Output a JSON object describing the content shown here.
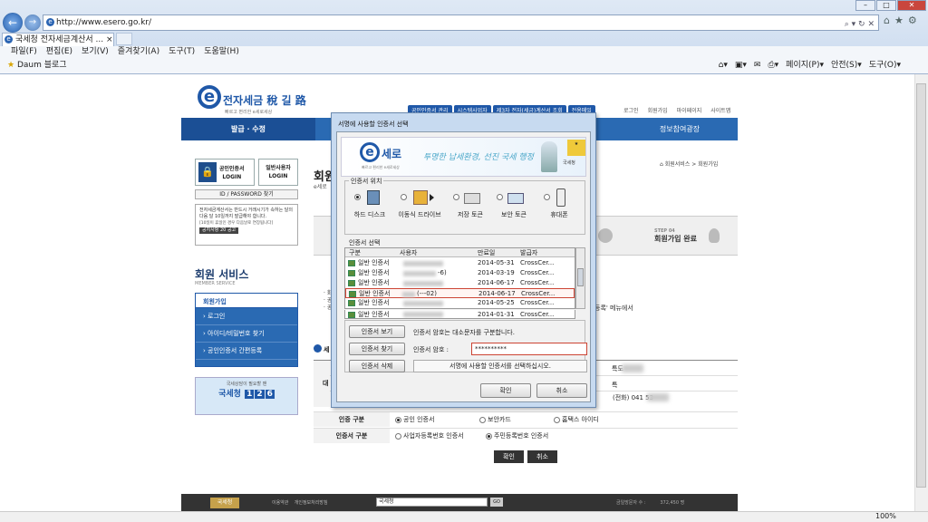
{
  "browser": {
    "url": "http://www.esero.go.kr/",
    "tab_title": "국세청 전자세금계산서 ...",
    "tab_close": "×",
    "menu": [
      "파일(F)",
      "편집(E)",
      "보기(V)",
      "즐겨찾기(A)",
      "도구(T)",
      "도움말(H)"
    ],
    "fav_item": "Daum 블로그",
    "cmd": [
      "페이지(P)▾",
      "안전(S)▾",
      "도구(O)▾"
    ],
    "zoom": "100%"
  },
  "site": {
    "logo_mark": "e",
    "logo_text": "전자세금 稅 길 路",
    "logo_sub": "빠르고 편리한 e세로세상",
    "top_links": [
      "공인인증서 관리",
      "시스템사업자",
      "제3자 전자(세금)계산서 조회",
      "전용메일"
    ],
    "top_links2": [
      "로그인",
      "회원가입",
      "마이페이지",
      "사이트맵"
    ],
    "nav_selected": "발급 · 수정",
    "nav_right": "정보참여광장",
    "cert_login": "공인인증서\nLOGIN",
    "gen_login": "일반사용자\nLOGIN",
    "idpw": "ID / PASSWORD 찾기",
    "notice_main": "전자세금계산서는 반드시 거래시기가 속하는 달의 다음 달 10일까지 발급해야 합니다.",
    "notice_sub": "[10일이 휴일인 경우 다음날로 연장됩니다]",
    "notice_btn": "공지사항 20 공고",
    "service_title": "회원 서비스",
    "service_sub": "MEMBER SERVICE",
    "side_header": "회원가입",
    "side_items": [
      "› 로그인",
      "› 아이디/비밀번호 찾기",
      "› 공인인증서 간편등록"
    ],
    "tax_a": "국세상담이 필요할 땐",
    "tax_b": "국세청",
    "tax_nums": [
      "1",
      "2",
      "6"
    ],
    "page_title": "회원",
    "page_sub": "e세로",
    "breadcrumb": "회원서비스 > 회원가입",
    "step4_label": "STEP 04",
    "step4_title": "회원가입 완료",
    "bullets": [
      "· 회",
      "· 공",
      "· 공"
    ],
    "menu_note": "등록' 메뉴에서",
    "section": "세",
    "row_label": "대",
    "rv1": "특도",
    "rv2": "특",
    "rv3": "(전화) 041 53",
    "cert_kind_label": "인증 구분",
    "cert_kind_opts": [
      "공인 인증서",
      "보안카드",
      "홈택스 아이디"
    ],
    "cert_type_label": "인증서 구분",
    "cert_type_opts": [
      "사업자등록번호 인증서",
      "주민등록번호 인증서"
    ],
    "btn_ok": "확인",
    "btn_cancel": "취소",
    "footer_links": "이용약관    개인정보처리방침",
    "footer_select": "국세청",
    "footer_go": "GO",
    "footer_count": "금일방문자 수 :          372,450 명",
    "footer_logo": "국세청"
  },
  "dialog": {
    "title": "서명에 사용할 인증서 선택",
    "banner_mark": "e",
    "banner_text": "세로",
    "banner_sub": "빠르고 편리한 e세로세상",
    "banner_slogan": "투명한 납세환경, 선진 국세 행정",
    "banner_nts": "국세청",
    "location_label": "인증서 위치",
    "locations": [
      "하드 디스크",
      "이동식 드라이브",
      "저장 토큰",
      "보안 토큰",
      "휴대폰"
    ],
    "list_label": "인증서 선택",
    "columns": [
      "구분",
      "사용자",
      "만료일",
      "발급자"
    ],
    "rows": [
      {
        "type": "일반 인증서",
        "user": "",
        "expiry": "2014-05-31",
        "issuer": "CrossCer..."
      },
      {
        "type": "일반 인증서",
        "user": "-6)",
        "expiry": "2014-03-19",
        "issuer": "CrossCer..."
      },
      {
        "type": "일반 인증서",
        "user": "",
        "expiry": "2014-06-17",
        "issuer": "CrossCer..."
      },
      {
        "type": "일반 인증서",
        "user": "(---02)",
        "expiry": "2014-06-17",
        "issuer": "CrossCer..."
      },
      {
        "type": "일반 인증서",
        "user": "",
        "expiry": "2014-05-25",
        "issuer": "CrossCer..."
      },
      {
        "type": "일반 인증서",
        "user": "",
        "expiry": "2014-01-31",
        "issuer": "CrossCer..."
      }
    ],
    "btn_view": "인증서 보기",
    "btn_find": "인증서 찾기",
    "btn_delete": "인증서 삭제",
    "case_note": "인증서 암호는 대소문자를 구분합니다.",
    "pw_label": "인증서 암호 :",
    "pw_value": "**********",
    "status_msg": "서명에 사용할 인증서를 선택하십시오.",
    "ok": "확인",
    "cancel": "취소"
  }
}
